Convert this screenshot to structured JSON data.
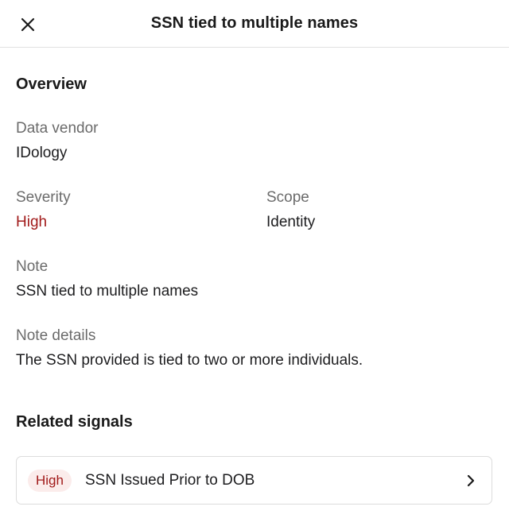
{
  "header": {
    "title": "SSN tied to multiple names"
  },
  "overview": {
    "title": "Overview",
    "data_vendor": {
      "label": "Data vendor",
      "value": "IDology"
    },
    "severity": {
      "label": "Severity",
      "value": "High"
    },
    "scope": {
      "label": "Scope",
      "value": "Identity"
    },
    "note": {
      "label": "Note",
      "value": "SSN tied to multiple names"
    },
    "note_details": {
      "label": "Note details",
      "value": "The SSN provided is tied to two or more individuals."
    }
  },
  "related": {
    "title": "Related signals",
    "signals": [
      {
        "severity": "High",
        "name": "SSN Issued Prior to DOB"
      }
    ]
  },
  "colors": {
    "high_text": "#a11a1a",
    "high_badge_bg": "#fbeceb",
    "label_gray": "#6b6b6b",
    "divider": "#e2e2e2"
  },
  "icons": {
    "close": "close-icon",
    "chevron": "chevron-right-icon"
  }
}
